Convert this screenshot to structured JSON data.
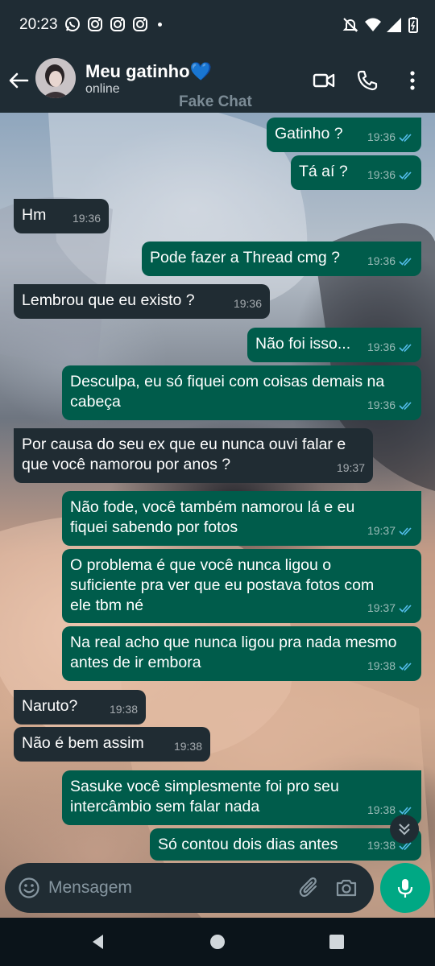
{
  "status_bar": {
    "time": "20:23",
    "notification_icons": [
      "whatsapp-icon",
      "instagram-icon",
      "instagram-icon",
      "instagram-icon"
    ],
    "right_icons": [
      "mute-icon",
      "wifi-icon",
      "signal-icon",
      "battery-icon"
    ]
  },
  "header": {
    "contact_name": "Meu gatinho💙",
    "contact_status": "online",
    "watermark": "Fake Chat"
  },
  "messages": [
    {
      "dir": "out",
      "text": "Gatinho ?",
      "time": "19:36",
      "read": true
    },
    {
      "dir": "out",
      "text": "Tá aí ?",
      "time": "19:36",
      "read": true
    },
    {
      "dir": "in",
      "text": "Hm",
      "time": "19:36"
    },
    {
      "dir": "out",
      "text": "Pode fazer a Thread cmg ?",
      "time": "19:36",
      "read": true
    },
    {
      "dir": "in",
      "text": "Lembrou que eu existo ?",
      "time": "19:36"
    },
    {
      "dir": "out",
      "text": "Não foi isso...",
      "time": "19:36",
      "read": true
    },
    {
      "dir": "out",
      "text": "Desculpa, eu só fiquei com coisas demais na\ncabeça",
      "time": "19:36",
      "read": true
    },
    {
      "dir": "in",
      "text": "Por causa do seu ex que eu nunca ouvi falar e\nque você namorou por anos ?",
      "time": "19:37"
    },
    {
      "dir": "out",
      "text": "Não fode, você também namorou lá e eu\nfiquei sabendo por fotos",
      "time": "19:37",
      "read": true
    },
    {
      "dir": "out",
      "text": "O problema é que você nunca ligou o\nsuficiente pra ver que eu postava fotos com\nele tbm né",
      "time": "19:37",
      "read": true
    },
    {
      "dir": "out",
      "text": "Na real acho que nunca ligou pra nada mesmo\nantes de ir embora",
      "time": "19:38",
      "read": true
    },
    {
      "dir": "in",
      "text": "Naruto?",
      "time": "19:38"
    },
    {
      "dir": "in",
      "text": "Não é bem assim",
      "time": "19:38"
    },
    {
      "dir": "out",
      "text": "Sasuke você simplesmente foi pro seu\nintercâmbio sem falar nada",
      "time": "19:38",
      "read": true
    },
    {
      "dir": "out",
      "text": "Só contou dois dias antes",
      "time": "19:38",
      "read": true
    }
  ],
  "input": {
    "placeholder": "Mensagem"
  },
  "colors": {
    "outgoing_bubble": "#005c4b",
    "incoming_bubble": "#202c33",
    "header_bg": "#1f2c34",
    "accent": "#00a884",
    "read_ticks": "#53bdeb"
  }
}
